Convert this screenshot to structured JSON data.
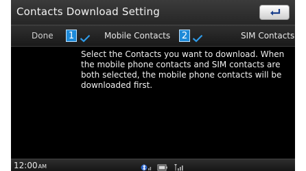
{
  "header": {
    "title": "Contacts Download Setting",
    "back_icon": "return-arrow-icon"
  },
  "options": {
    "done_label": "Done",
    "mobile_label": "Mobile Contacts",
    "sim_label": "SIM Contacts",
    "badge_1": "1",
    "badge_2": "2",
    "mobile_checked": true,
    "sim_checked": true,
    "check_color": "#2f9be8"
  },
  "message": {
    "text": "Select the Contacts you want to download. When the mobile phone contacts and SIM contacts are both selected, the mobile phone contacts will be downloaded first."
  },
  "status": {
    "time": "12:00",
    "ampm": "AM",
    "icons": [
      "bluetooth-icon",
      "battery-icon",
      "signal-icon"
    ]
  }
}
